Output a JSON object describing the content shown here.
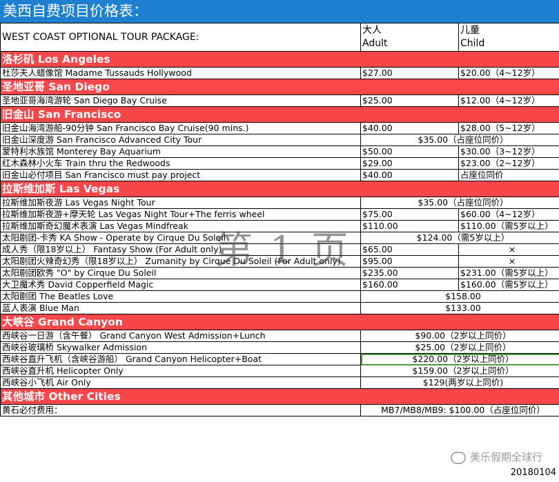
{
  "title": "美西自费项目价格表：",
  "header": {
    "package": "WEST COAST OPTIONAL TOUR PACKAGE:",
    "adult_cn": "大人",
    "adult_en": "Adult",
    "child_cn": "儿童",
    "child_en": "Child"
  },
  "sections": {
    "la": "洛杉矶 Los Angeles",
    "sd": "圣地亚哥 San Diego",
    "sf": "旧金山 San Francisco",
    "lv": "拉斯维加斯 Las Vegas",
    "gc": "大峡谷 Grand Canyon",
    "oc": "其他城市 Other Cities"
  },
  "rows": {
    "la1": {
      "name": "杜莎夫人蜡像馆 Madame Tussauds Hollywood",
      "adult": "$27.00",
      "child": "$20.00（4~12岁）"
    },
    "sd1": {
      "name": "圣地亚哥海湾游轮 San Diego Bay Cruise",
      "adult": "$25.00",
      "child": "$12.00（4~12岁）"
    },
    "sf1": {
      "name": "旧金山海湾游船-90分钟 San Francisco Bay Cruise(90 mins.)",
      "adult": "$40.00",
      "child": "$28.00（5~12岁）"
    },
    "sf2": {
      "name": "旧金山深度游 San Francisco Advanced City Tour",
      "price": "$35.00（占座位同价）"
    },
    "sf3": {
      "name": "蒙特利水族馆 Monterey Bay Aquarium",
      "adult": "$50.00",
      "child": "$30.00（3~12岁）"
    },
    "sf4": {
      "name": "红木森林小火车 Train thru the Redwoods",
      "adult": "$29.00",
      "child": "$23.00（2~12岁）"
    },
    "sf5": {
      "name": "旧金山必付项目  San Francisco must pay project",
      "adult": "$40.00",
      "child": "占座位同价"
    },
    "lv1": {
      "name": "拉斯维加斯夜游 Las Vegas Night Tour",
      "price": "$35.00（占座位同价）"
    },
    "lv2": {
      "name": "拉斯维加斯夜游+摩天轮 Las Vegas Night Tour+The ferris wheel",
      "adult": "$75.00",
      "child": "$60.00（4~12岁）"
    },
    "lv3": {
      "name": "拉斯维加斯奇幻魔术表演 Las Vegas Mindfreak",
      "adult": "$110.00",
      "child": "$110.00（需5岁以上）"
    },
    "lv4": {
      "name": "太阳剧团-卡秀 KA Show - Operate by Cirque Du Soleil",
      "price": "$124.00（需5岁以上）"
    },
    "lv5": {
      "name": "成人秀（限18岁以上） Fantasy Show (For Adult only)",
      "adult": "$65.00",
      "child": "×"
    },
    "lv6": {
      "name": "太阳剧团火辣奇幻秀（限18岁以上） Zumanity by Cirque Du Soleil (For Adult only)",
      "adult": "$95.00",
      "child": "×"
    },
    "lv7": {
      "name": "太阳剧团欧秀 \"O\" by Cirque Du Soleil",
      "adult": "$235.00",
      "child": "$231.00（需5岁以上）"
    },
    "lv8": {
      "name": "大卫魔术秀 David Copperfield Magic",
      "adult": "$160.00",
      "child": "$160.00（需5岁以上）"
    },
    "lv9": {
      "name": "太阳剧团 The Beatles Love",
      "price": "$158.00"
    },
    "lv10": {
      "name": "蓝人表演 Blue Man",
      "price": "$133.00"
    },
    "gc1": {
      "name": "西峡谷一日游（含午餐） Grand Canyon West Admission+Lunch",
      "price": "$90.00（2岁以上同价）"
    },
    "gc2": {
      "name": "西峡谷玻璃桥 Skywalker Admission",
      "price": "$25.00（2岁以上同价）"
    },
    "gc3": {
      "name": "西峡谷直升飞机（含峡谷游船） Grand Canyon Helicopter+Boat",
      "price": "$220.00（2岁以上同价）"
    },
    "gc4": {
      "name": "西峡谷直升机 Helicopter Only",
      "price": "$159.00（2岁以上同价）"
    },
    "gc5": {
      "name": "西峡谷小飞机 Air Only",
      "price": "$129(两岁以上同价)"
    },
    "oc1": {
      "name": "黄石必付费用：",
      "price": "MB7/MB8/MB9: $100.00（占座位同价）"
    }
  },
  "watermark": "第 1 页",
  "brand": "美乐假期全球行",
  "date": "20180104",
  "colors": {
    "title_bar": "#1f7fd0",
    "section_bar": "#f7474b",
    "highlight_border": "#4e9a3e"
  }
}
